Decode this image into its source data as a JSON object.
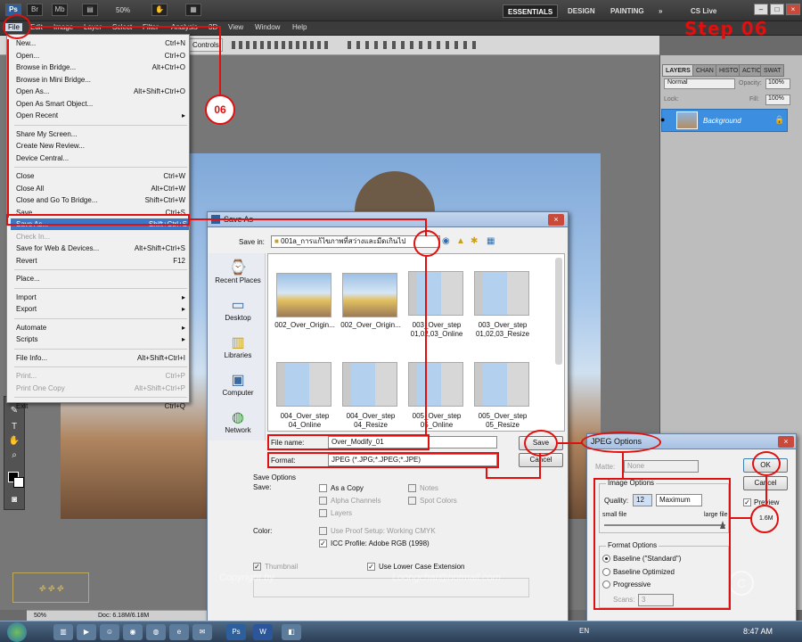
{
  "topbar": {
    "zoom": "50%",
    "workspaces": [
      "ESSENTIALS",
      "DESIGN",
      "PAINTING"
    ],
    "more": "»",
    "cslive": "CS Live"
  },
  "menubar": {
    "items": [
      "File",
      "Edit",
      "Image",
      "Layer",
      "Select",
      "Filter",
      "Analysis",
      "3D",
      "View",
      "Window",
      "Help"
    ]
  },
  "optbar": {
    "controls": "Controls"
  },
  "annotation": {
    "step": "Step 06",
    "badge": "06"
  },
  "file_menu": [
    {
      "label": "New...",
      "sc": "Ctrl+N"
    },
    {
      "label": "Open...",
      "sc": "Ctrl+O"
    },
    {
      "label": "Browse in Bridge...",
      "sc": "Alt+Ctrl+O"
    },
    {
      "label": "Browse in Mini Bridge...",
      "sc": ""
    },
    {
      "label": "Open As...",
      "sc": "Alt+Shift+Ctrl+O"
    },
    {
      "label": "Open As Smart Object...",
      "sc": ""
    },
    {
      "label": "Open Recent",
      "sc": "▸"
    },
    {
      "label": "Share My Screen...",
      "sc": ""
    },
    {
      "label": "Create New Review...",
      "sc": ""
    },
    {
      "label": "Device Central...",
      "sc": ""
    },
    {
      "label": "Close",
      "sc": "Ctrl+W"
    },
    {
      "label": "Close All",
      "sc": "Alt+Ctrl+W"
    },
    {
      "label": "Close and Go To Bridge...",
      "sc": "Shift+Ctrl+W"
    },
    {
      "label": "Save",
      "sc": "Ctrl+S"
    },
    {
      "label": "Save As...",
      "sc": "Shift+Ctrl+S"
    },
    {
      "label": "Check In...",
      "sc": ""
    },
    {
      "label": "Save for Web & Devices...",
      "sc": "Alt+Shift+Ctrl+S"
    },
    {
      "label": "Revert",
      "sc": "F12"
    },
    {
      "label": "Place...",
      "sc": ""
    },
    {
      "label": "Import",
      "sc": "▸"
    },
    {
      "label": "Export",
      "sc": "▸"
    },
    {
      "label": "Automate",
      "sc": "▸"
    },
    {
      "label": "Scripts",
      "sc": "▸"
    },
    {
      "label": "File Info...",
      "sc": "Alt+Shift+Ctrl+I"
    },
    {
      "label": "Print...",
      "sc": "Ctrl+P"
    },
    {
      "label": "Print One Copy",
      "sc": "Alt+Shift+Ctrl+P"
    },
    {
      "label": "Exit",
      "sc": "Ctrl+Q"
    }
  ],
  "layers_panel": {
    "tabs": [
      "LAYERS",
      "CHAN",
      "HISTO",
      "ACTIC",
      "SWAT"
    ],
    "blend_mode": "Normal",
    "opacity_label": "Opacity:",
    "opacity": "100%",
    "lock_label": "Lock:",
    "fill_label": "Fill:",
    "fill": "100%",
    "layer_name": "Background"
  },
  "status": {
    "zoom": "50%",
    "doc": "Doc: 6.18M/6.18M"
  },
  "save_as": {
    "title": "Save As",
    "save_in_label": "Save in:",
    "folder": "001a_การแก้ไขภาพที่สว่างและมืดเกินไป",
    "places": [
      "Recent Places",
      "Desktop",
      "Libraries",
      "Computer",
      "Network"
    ],
    "files": [
      {
        "name": "002_Over_Origin..."
      },
      {
        "name": "002_Over_Origin..."
      },
      {
        "name": "003_Over_step 01,02,03_Online"
      },
      {
        "name": "003_Over_step 01,02,03_Resize"
      },
      {
        "name": "004_Over_step 04_Online"
      },
      {
        "name": "004_Over_step 04_Resize"
      },
      {
        "name": "005_Over_step 05_Online"
      },
      {
        "name": "005_Over_step 05_Resize"
      }
    ],
    "filename_label": "File name:",
    "filename": "Over_Modify_01",
    "format_label": "Format:",
    "format": "JPEG (*.JPG;*.JPEG;*.JPE)",
    "save_btn": "Save",
    "cancel_btn": "Cancel",
    "save_options": "Save Options",
    "save_label": "Save:",
    "as_copy": "As a Copy",
    "notes": "Notes",
    "alpha": "Alpha Channels",
    "spot": "Spot Colors",
    "layers": "Layers",
    "color_label": "Color:",
    "proof": "Use Proof Setup:  Working CMYK",
    "icc": "ICC Profile:  Adobe RGB (1998)",
    "thumbnail": "Thumbnail",
    "lowercase": "Use Lower Case Extension"
  },
  "jpeg": {
    "title": "JPEG Options",
    "matte_label": "Matte:",
    "matte": "None",
    "ok": "OK",
    "cancel": "Cancel",
    "preview": "Preview",
    "size": "1.6M",
    "image_options": "Image Options",
    "quality_label": "Quality:",
    "quality": "12",
    "quality_preset": "Maximum",
    "small_file": "small file",
    "large_file": "large file",
    "format_options": "Format Options",
    "baseline": "Baseline (\"Standard\")",
    "baseline_opt": "Baseline Optimized",
    "progressive": "Progressive",
    "scans_label": "Scans:",
    "scans": "3"
  },
  "taskbar": {
    "lang": "EN",
    "time": "8:47 AM"
  },
  "watermark": {
    "text1": "Copyright by",
    "text2": "Loongchat@hotmail.com"
  },
  "colors": {
    "accent": "#e01010",
    "selection": "#3c76c6",
    "layer": "#3c8fe0"
  }
}
